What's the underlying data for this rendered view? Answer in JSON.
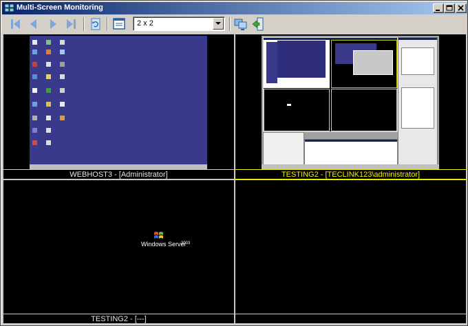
{
  "window": {
    "title": "Multi-Screen Monitoring"
  },
  "toolbar": {
    "layout_value": "2 x 2",
    "icons": [
      "first-screen-icon",
      "previous-screen-icon",
      "next-screen-icon",
      "last-screen-icon",
      "refresh-icon",
      "view-icon",
      "computer-icon",
      "exit-icon"
    ]
  },
  "panes": [
    {
      "label": "WEBHOST3 - [Administrator]",
      "selected": false
    },
    {
      "label": "TESTING2 - [TECLINK123\\administrator]",
      "selected": true
    },
    {
      "label": "TESTING2 - [---]",
      "selected": false
    },
    {
      "label": "",
      "selected": false
    }
  ],
  "splash": {
    "brand": "Windows Server",
    "edition": "2003"
  },
  "colors": {
    "selected_border": "#f0f000",
    "pane_border": "#c8c8c8",
    "title_gradient_start": "#0a246a",
    "title_gradient_end": "#a6caf0"
  }
}
